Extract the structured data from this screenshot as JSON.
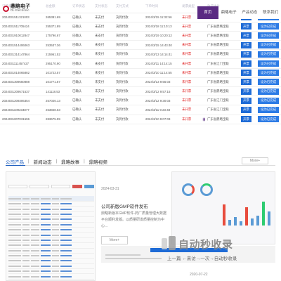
{
  "brand": {
    "name_cn": "鼎略电子",
    "name_en": "DL Electronic"
  },
  "nav": {
    "items": [
      {
        "label": "首页",
        "active": true
      },
      {
        "label": "鼎略电子",
        "active": false
      },
      {
        "label": "产品动态",
        "active": false
      },
      {
        "label": "联系我们",
        "active": false
      }
    ]
  },
  "orders": {
    "headers": [
      "订单号",
      "总金额",
      "订单状态",
      "支付状态",
      "支付方式",
      "下单时间",
      "发票类型",
      "",
      "收货地址",
      "",
      ""
    ],
    "rows": [
      [
        "2024031511321003",
        "265381.69",
        "已确认",
        "未支付",
        "货到付款",
        "2024/3/15 11:32:56",
        "未开票",
        "",
        "广东省",
        "查看",
        "设为已发货"
      ],
      [
        "2024031511705424",
        "255371.89",
        "已确认",
        "未支付",
        "货到付款",
        "2024/3/18 11:10:13",
        "未开票",
        "",
        "广东省鼎略宝联",
        "开票",
        "设为已完成"
      ],
      [
        "2024031910012847",
        "175796.67",
        "已确认",
        "未支付",
        "货到付款",
        "2024/3/19 10:20:12",
        "未开票",
        "",
        "广东省鼎略宝联",
        "开票",
        "设为已完成"
      ],
      [
        "2024031514406063",
        "253537.36",
        "已确认",
        "未支付",
        "货到付款",
        "2024/3/15 14:43:40",
        "未开票",
        "",
        "广东省鼎略宝联",
        "开票",
        "设为已完成"
      ],
      [
        "2024031314147864",
        "215961.52",
        "已确认",
        "未支付",
        "货到付款",
        "2024/3/13 14:14:41",
        "未开票",
        "",
        "广东省鼎略宝联",
        "开票",
        "设为已完成"
      ],
      [
        "2024031111457427",
        "295170.90",
        "已确认",
        "未支付",
        "货到付款",
        "2024/3/11 14:14:15",
        "未开票",
        "",
        "广东省江门宝联",
        "开票",
        "设为已完成"
      ],
      [
        "2024031014065882",
        "101723.57",
        "已确认",
        "未支付",
        "货到付款",
        "2024/3/10 11:14:55",
        "未开票",
        "",
        "广东省鼎略宝联",
        "开票",
        "设为已完成"
      ],
      [
        "2024031309550888",
        "101771.57",
        "已确认",
        "未支付",
        "货到付款",
        "2024/3/13 9:55:03",
        "未开票",
        "",
        "广东省鼎略宝联",
        "开票",
        "设为已完成"
      ],
      [
        "2024031209571537",
        "141118.53",
        "已确认",
        "未支付",
        "货到付款",
        "2024/3/12 9:57:15",
        "未开票",
        "",
        "广东省鼎略宝联",
        "开票",
        "设为已完成"
      ],
      [
        "2024031209306354",
        "257026.13",
        "已确认",
        "未支付",
        "货到付款",
        "2024/3/12 9:30:03",
        "未开票",
        "",
        "广东省江门宝联",
        "开票",
        "设为已完成"
      ],
      [
        "2024031109234877",
        "263848.63",
        "已确认",
        "未支付",
        "货到付款",
        "2024/3/11 9:23:48",
        "未开票",
        "",
        "广东省江门宝联",
        "开票",
        "设为已完成"
      ],
      [
        "2024031007031596",
        "283675.99",
        "已确认",
        "未支付",
        "货到付款",
        "2024/3/10 9:07:03",
        "未开票",
        "",
        "广东省鼎略宝联",
        "开票",
        "设为已完成"
      ]
    ]
  },
  "section": {
    "tabs": [
      {
        "label": "公司产品",
        "active": true
      },
      {
        "label": "新闻动态",
        "active": false
      },
      {
        "label": "鼎略故事",
        "active": false
      },
      {
        "label": "鼎略视频",
        "active": false
      }
    ],
    "more_label": "More+"
  },
  "news": {
    "date": "2024-03-31",
    "title": "公司新版GMP软件发布",
    "body": "鼎略新版本GMP软件-药厂质量管理大数据平台顺利发版。以质量研发质量控制为中心...",
    "more_label": "More+",
    "date2": "2020-07-22"
  },
  "watermark": {
    "main": "自动秒收录",
    "sub": "上一篇 ←来访→一次→自动秒收录"
  },
  "colors": {
    "nav_active": "#5a2a82",
    "button": "#1e6bd6",
    "alert_red": "#e02020",
    "section_accent": "#1f5fbf"
  }
}
